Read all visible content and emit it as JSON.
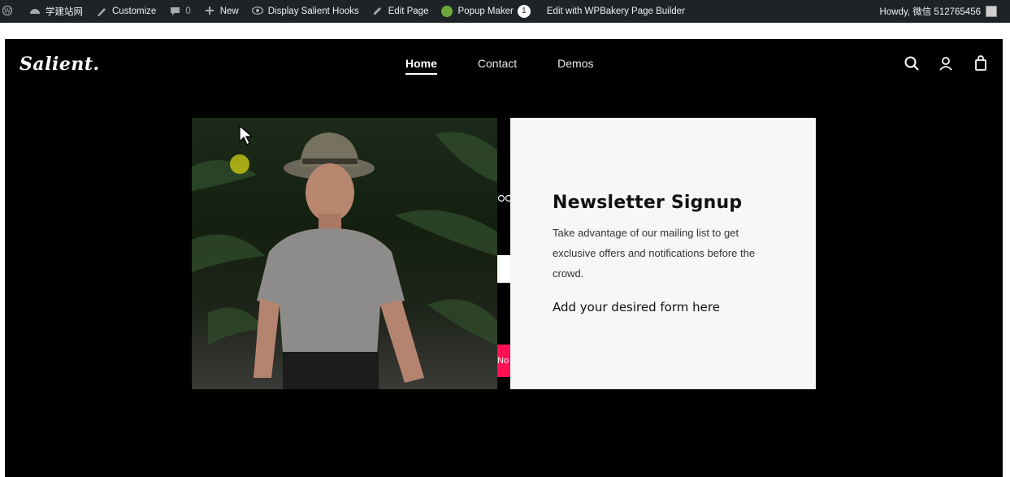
{
  "admin_bar": {
    "site_name": "学建站网",
    "customize": "Customize",
    "comments_count": "0",
    "new_label": "New",
    "hooks_label": "Display Salient Hooks",
    "edit_page": "Edit Page",
    "popup_maker": "Popup Maker",
    "popup_count": "1",
    "wpbakery": "Edit with WPBakery Page Builder",
    "howdy": "Howdy, 微信 512765456"
  },
  "site": {
    "logo": "Salient.",
    "nav": [
      {
        "label": "Home",
        "active": true
      },
      {
        "label": "Contact",
        "active": false
      },
      {
        "label": "Demos",
        "active": false
      }
    ],
    "peek_cta": "No"
  },
  "popup": {
    "title": "Newsletter Signup",
    "body": "Take advantage of our mailing list to get exclusive offers and notifications before the crowd.",
    "form_placeholder": "Add your desired form here"
  },
  "colors": {
    "admin_bar_bg": "#1d2327",
    "site_bg": "#000000",
    "accent": "#ff1053",
    "popup_panel_bg": "#f7f7f7"
  }
}
